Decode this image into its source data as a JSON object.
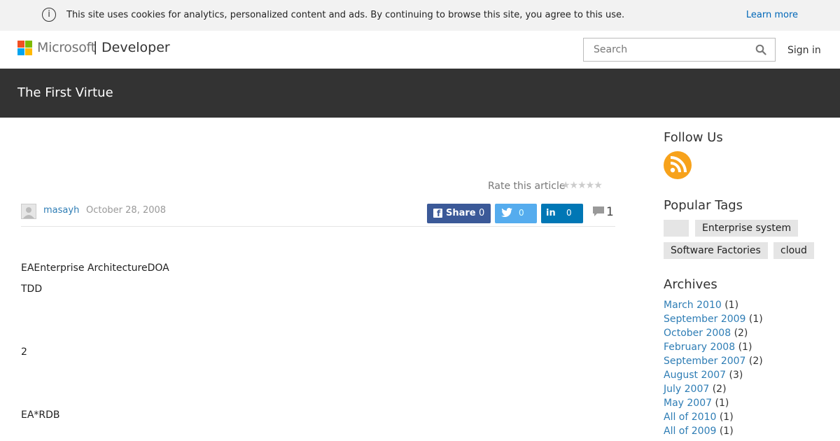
{
  "cookie": {
    "message": "This site uses cookies for analytics, personalized content and ads. By continuing to browse this site, you agree to this use.",
    "learn_more": "Learn more",
    "info_glyph": "i"
  },
  "header": {
    "brand": "Microsoft",
    "separator": "|",
    "section": "Developer",
    "search_placeholder": "Search",
    "sign_in": "Sign in",
    "logo_colors": [
      "#f25022",
      "#7fba00",
      "#00a4ef",
      "#ffb900"
    ]
  },
  "blog": {
    "title": "The First Virtue"
  },
  "article": {
    "rate_label": "Rate this article",
    "stars": "★★★★★",
    "author": "masayh",
    "date": "October 28, 2008",
    "share": {
      "facebook_label": "Share",
      "facebook_count": "0",
      "twitter_count": "0",
      "linkedin_count": "0"
    },
    "comment_count": "1",
    "paragraphs": [
      "EAEnterprise ArchitectureDOA",
      "TDD",
      "2",
      "EA*RDB"
    ]
  },
  "sidebar": {
    "follow_heading": "Follow Us",
    "tags_heading": "Popular Tags",
    "tags": [
      "",
      "Enterprise system",
      "Software Factories",
      "cloud"
    ],
    "archives_heading": "Archives",
    "archives": [
      {
        "label": "March 2010",
        "count": "(1)"
      },
      {
        "label": "September 2009",
        "count": "(1)"
      },
      {
        "label": "October 2008",
        "count": "(2)"
      },
      {
        "label": "February 2008",
        "count": "(1)"
      },
      {
        "label": "September 2007",
        "count": "(2)"
      },
      {
        "label": "August 2007",
        "count": "(3)"
      },
      {
        "label": "July 2007",
        "count": "(2)"
      },
      {
        "label": "May 2007",
        "count": "(1)"
      },
      {
        "label": "All of 2010",
        "count": "(1)"
      },
      {
        "label": "All of 2009",
        "count": "(1)"
      }
    ]
  },
  "colors": {
    "accent_link": "#2e7db5",
    "facebook": "#3b5998",
    "twitter": "#55acee",
    "linkedin": "#0077b5",
    "rss": "#f7a21b",
    "title_bar": "#333333"
  }
}
